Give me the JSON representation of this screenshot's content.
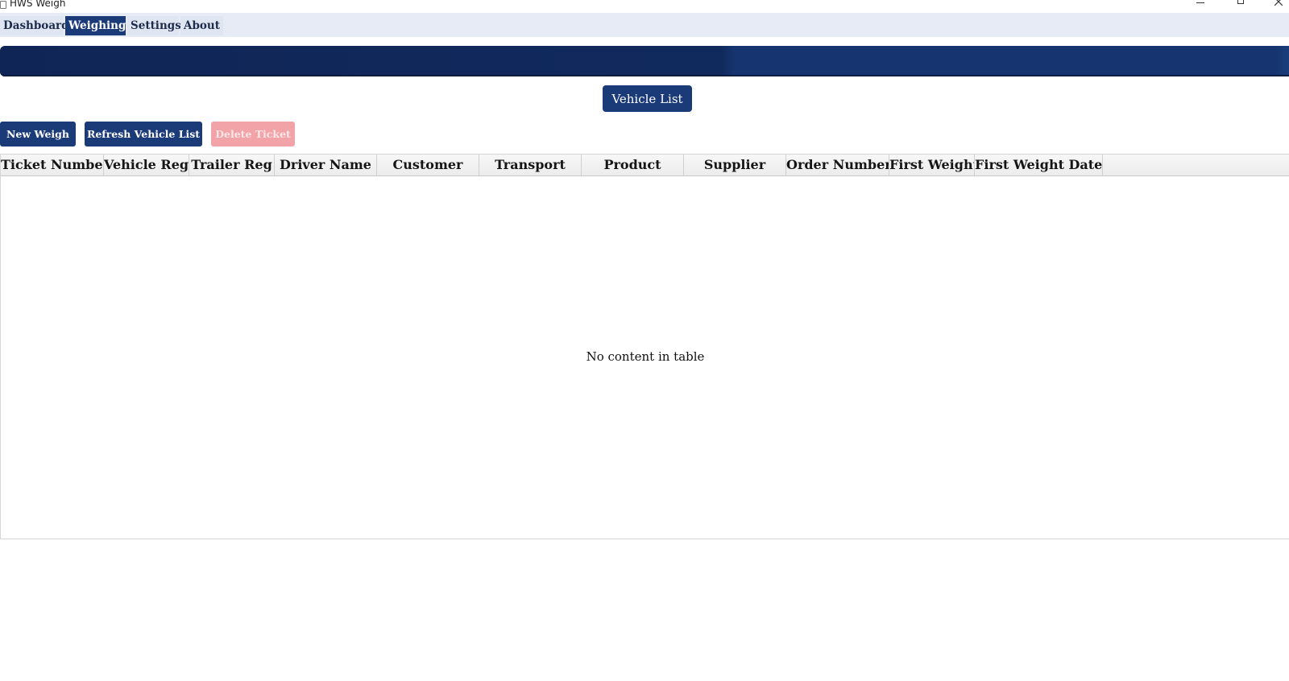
{
  "window": {
    "title": "HWS Weigh"
  },
  "tabs": [
    {
      "label": "Dashboard",
      "active": false
    },
    {
      "label": "Weighing",
      "active": true
    },
    {
      "label": "Settings",
      "active": false
    },
    {
      "label": "About",
      "active": false
    }
  ],
  "main": {
    "vehicle_list_label": "Vehicle List",
    "new_weigh_label": "New Weigh",
    "refresh_label": "Refresh Vehicle List",
    "delete_label": "Delete Ticket"
  },
  "table": {
    "columns": [
      "Ticket Number",
      "Vehicle Reg",
      "Trailer Reg",
      "Driver Name",
      "Customer",
      "Transport",
      "Product",
      "Supplier",
      "Order Number",
      "First Weight",
      "First Weight Date..."
    ],
    "empty_message": "No content in table"
  },
  "colors": {
    "accent": "#1b3a78",
    "banner": "#112a5e",
    "delete_disabled": "#f2a3a8"
  }
}
